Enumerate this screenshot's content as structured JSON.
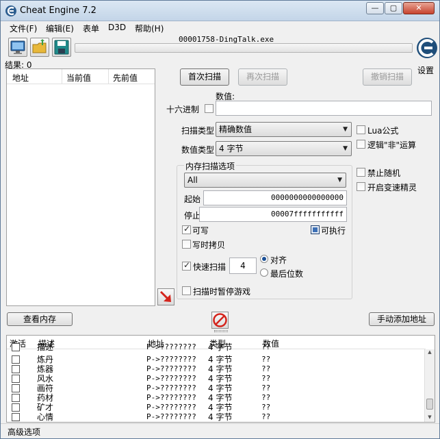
{
  "window": {
    "title": "Cheat Engine 7.2"
  },
  "menu": {
    "items": [
      "文件(F)",
      "编辑(E)",
      "表单",
      "D3D",
      "帮助(H)"
    ]
  },
  "process": {
    "name": "00001758-DingTalk.exe"
  },
  "toolbar": {
    "settings_label": "设置"
  },
  "results": {
    "label": "结果: 0"
  },
  "found_list": {
    "columns": [
      "地址",
      "当前值",
      "先前值"
    ]
  },
  "scan": {
    "first_scan": "首次扫描",
    "next_scan": "再次扫描",
    "undo_scan": "撤销扫描",
    "value_label": "数值:",
    "hex_label": "十六进制",
    "value": "",
    "scan_type_label": "扫描类型",
    "scan_type": "精确数值",
    "value_type_label": "数值类型",
    "value_type": "4 字节",
    "lua_formula": "Lua公式",
    "not_logic": "逻辑\"非\"运算",
    "no_random": "禁止随机",
    "speedhack": "开启变速精灵"
  },
  "memory_options": {
    "title": "内存扫描选项",
    "region": "All",
    "start_label": "起始",
    "start_value": "0000000000000000",
    "stop_label": "停止",
    "stop_value": "00007fffffffffff",
    "writable": "可写",
    "executable": "可执行",
    "copy_on_write": "写时拷贝",
    "fast_scan": "快速扫描",
    "fast_scan_value": "4",
    "align": "对齐",
    "last_digits": "最后位数",
    "pause_game": "扫描时暂停游戏"
  },
  "buttons": {
    "view_memory": "查看内存",
    "add_address": "手动添加地址"
  },
  "address_table": {
    "columns": [
      "激活",
      "描述",
      "地址",
      "类型",
      "数值"
    ],
    "rows": [
      {
        "desc": "描述",
        "addr": "P->????????",
        "type": "4 字节",
        "value": "??"
      },
      {
        "desc": "炼丹",
        "addr": "P->????????",
        "type": "4 字节",
        "value": "??"
      },
      {
        "desc": "炼器",
        "addr": "P->????????",
        "type": "4 字节",
        "value": "??"
      },
      {
        "desc": "风水",
        "addr": "P->????????",
        "type": "4 字节",
        "value": "??"
      },
      {
        "desc": "画符",
        "addr": "P->????????",
        "type": "4 字节",
        "value": "??"
      },
      {
        "desc": "药材",
        "addr": "P->????????",
        "type": "4 字节",
        "value": "??"
      },
      {
        "desc": "矿才",
        "addr": "P->????????",
        "type": "4 字节",
        "value": "??"
      },
      {
        "desc": "心情",
        "addr": "P->????????",
        "type": "4 字节",
        "value": "??"
      }
    ]
  },
  "status": {
    "advanced": "高级选项"
  }
}
